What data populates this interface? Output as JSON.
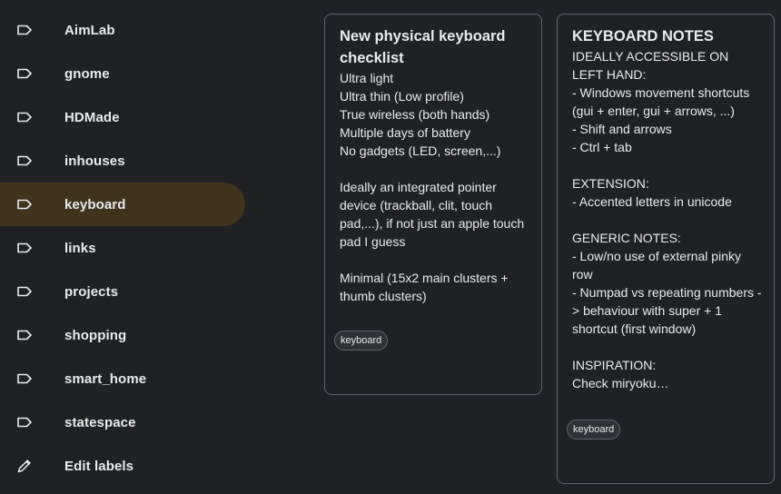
{
  "sidebar": {
    "items": [
      {
        "label": "AimLab",
        "icon": "label-icon"
      },
      {
        "label": "gnome",
        "icon": "label-icon"
      },
      {
        "label": "HDMade",
        "icon": "label-icon"
      },
      {
        "label": "inhouses",
        "icon": "label-icon"
      },
      {
        "label": "keyboard",
        "icon": "label-icon",
        "active": true
      },
      {
        "label": "links",
        "icon": "label-icon"
      },
      {
        "label": "projects",
        "icon": "label-icon"
      },
      {
        "label": "shopping",
        "icon": "label-icon"
      },
      {
        "label": "smart_home",
        "icon": "label-icon"
      },
      {
        "label": "statespace",
        "icon": "label-icon"
      },
      {
        "label": "Edit labels",
        "icon": "pencil-icon"
      }
    ],
    "active_color": "#41331c"
  },
  "notes": [
    {
      "title": "New physical keyboard checklist",
      "body": "Ultra light\nUltra thin (Low profile)\nTrue wireless (both hands)\nMultiple days of battery\nNo gadgets (LED, screen,...)\n\nIdeally an integrated pointer device (trackball, clit, touch pad,...), if not just an apple touch pad I guess\n\nMinimal (15x2 main clusters + thumb clusters)",
      "label": "keyboard"
    },
    {
      "title": "KEYBOARD NOTES",
      "body": "IDEALLY ACCESSIBLE ON LEFT HAND:\n- Windows movement shortcuts (gui + enter, gui + arrows, ...)\n- Shift and arrows\n- Ctrl + tab\n\nEXTENSION:\n- Accented letters in unicode\n\nGENERIC NOTES:\n- Low/no use of external pinky row\n- Numpad vs repeating numbers -> behaviour with super + 1 shortcut (first window)\n\nINSPIRATION:\nCheck miryoku…",
      "label": "keyboard"
    }
  ]
}
